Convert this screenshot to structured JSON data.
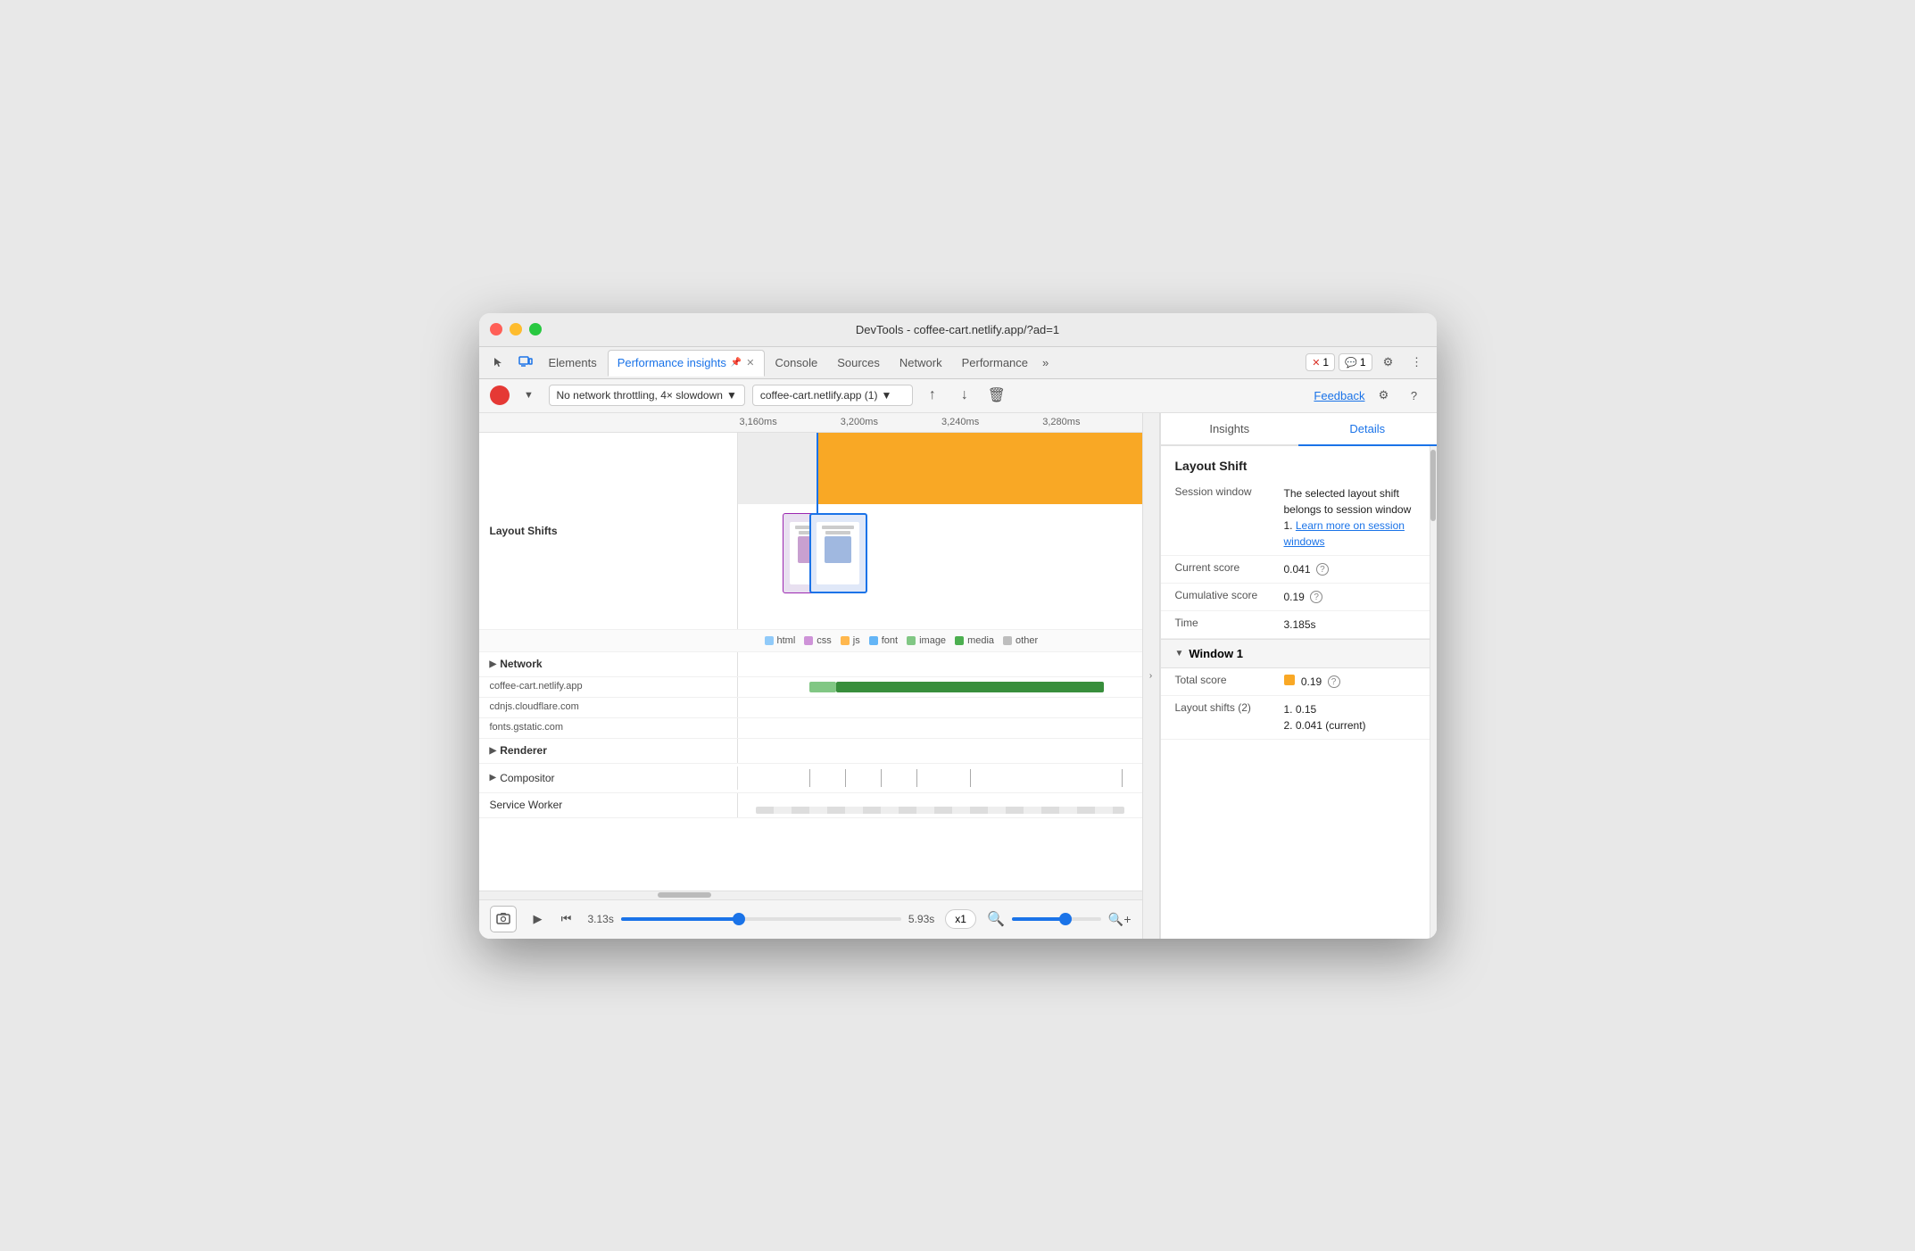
{
  "window": {
    "title": "DevTools - coffee-cart.netlify.app/?ad=1"
  },
  "tabs": {
    "items": [
      {
        "label": "Elements",
        "active": false
      },
      {
        "label": "Performance insights",
        "active": true,
        "pinned": true
      },
      {
        "label": "Console",
        "active": false
      },
      {
        "label": "Sources",
        "active": false
      },
      {
        "label": "Network",
        "active": false
      },
      {
        "label": "Performance",
        "active": false
      }
    ],
    "overflow": "»",
    "error_badge": "1",
    "message_badge": "1"
  },
  "toolbar": {
    "throttling": "No network throttling, 4× slowdown",
    "url": "coffee-cart.netlify.app (1)",
    "feedback_label": "Feedback"
  },
  "timeline": {
    "ruler": [
      "3,160ms",
      "3,200ms",
      "3,240ms",
      "3,280ms"
    ],
    "sections": {
      "layout_shifts": "Layout Shifts",
      "network": "Network",
      "network_items": [
        "coffee-cart.netlify.app",
        "cdnjs.cloudflare.com",
        "fonts.gstatic.com"
      ],
      "renderer": "Renderer",
      "compositor": "Compositor",
      "service_worker": "Service Worker"
    },
    "legend": {
      "items": [
        {
          "label": "html",
          "color": "#90caf9"
        },
        {
          "label": "css",
          "color": "#ce93d8"
        },
        {
          "label": "js",
          "color": "#ffb74d"
        },
        {
          "label": "font",
          "color": "#64b5f6"
        },
        {
          "label": "image",
          "color": "#81c784"
        },
        {
          "label": "media",
          "color": "#4caf50"
        },
        {
          "label": "other",
          "color": "#bdbdbd"
        }
      ]
    }
  },
  "bottom_bar": {
    "time_start": "3.13s",
    "time_end": "5.93s",
    "speed": "x1",
    "zoom_minus": "−",
    "zoom_plus": "+"
  },
  "right_panel": {
    "tabs": [
      "Insights",
      "Details"
    ],
    "active_tab": "Details",
    "section_title": "Layout Shift",
    "details": {
      "session_window_key": "Session window",
      "session_window_val": "The selected layout shift belongs to session window 1.",
      "session_window_link": "Learn more on session windows",
      "current_score_key": "Current score",
      "current_score_val": "0.041",
      "cumulative_score_key": "Cumulative score",
      "cumulative_score_val": "0.19",
      "time_key": "Time",
      "time_val": "3.185s"
    },
    "window1": {
      "label": "Window 1",
      "total_score_key": "Total score",
      "total_score_val": "0.19",
      "layout_shifts_key": "Layout shifts (2)",
      "layout_shift_1": "1. 0.15",
      "layout_shift_2": "2. 0.041 (current)"
    }
  }
}
